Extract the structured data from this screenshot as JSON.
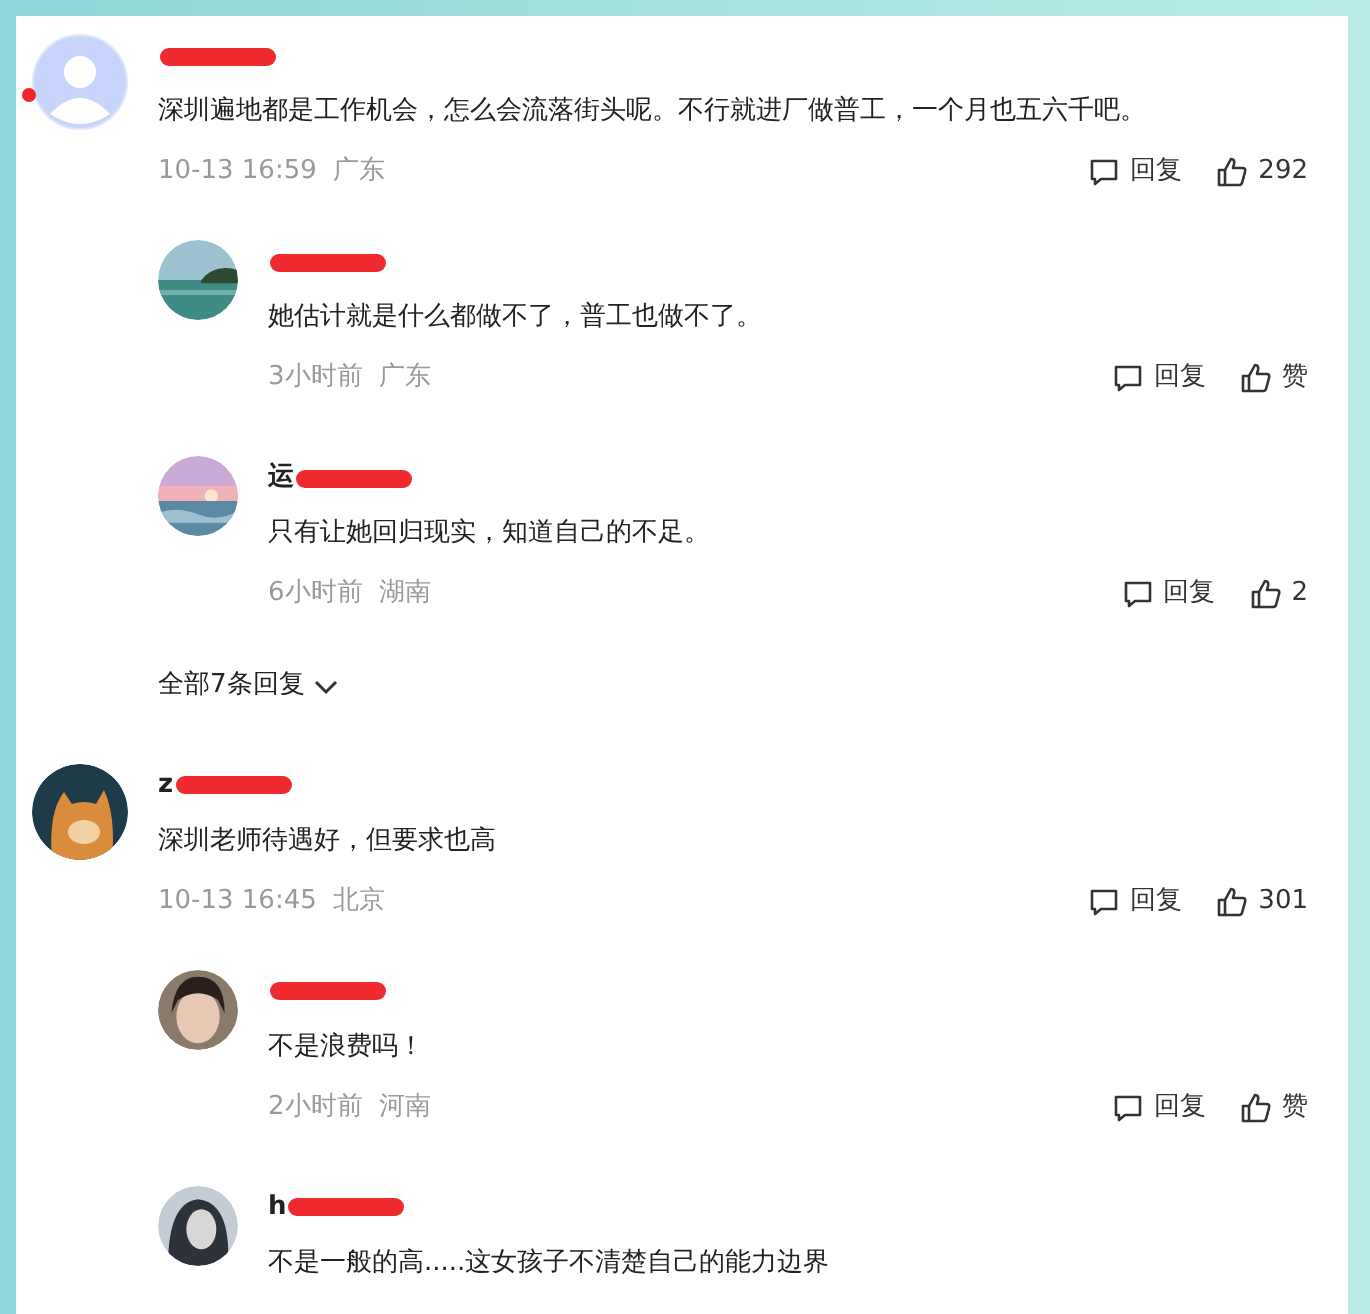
{
  "comments": [
    {
      "avatar": {
        "kind": "placeholder"
      },
      "unread": true,
      "text": "深圳遍地都是工作机会，怎么会流落街头呢。不行就进厂做普工，一个月也五六千吧。",
      "time": "10-13 16:59",
      "location": "广东",
      "reply_label": "回复",
      "like_label": "292",
      "replies": [
        {
          "text": "她估计就是什么都做不了，普工也做不了。",
          "time": "3小时前",
          "location": "广东",
          "reply_label": "回复",
          "like_label": "赞"
        },
        {
          "name": "运",
          "text": "只有让她回归现实，知道自己的不足。",
          "time": "6小时前",
          "location": "湖南",
          "reply_label": "回复",
          "like_label": "2"
        }
      ],
      "more_replies": "全部7条回复"
    },
    {
      "name": "z",
      "unread": false,
      "text": "深圳老师待遇好，但要求也高",
      "time": "10-13 16:45",
      "location": "北京",
      "reply_label": "回复",
      "like_label": "301",
      "replies": [
        {
          "text": "不是浪费吗！",
          "time": "2小时前",
          "location": "河南",
          "reply_label": "回复",
          "like_label": "赞"
        },
        {
          "name": "h",
          "text": "不是一般的高.....这女孩子不清楚自己的能力边界"
        }
      ]
    }
  ]
}
